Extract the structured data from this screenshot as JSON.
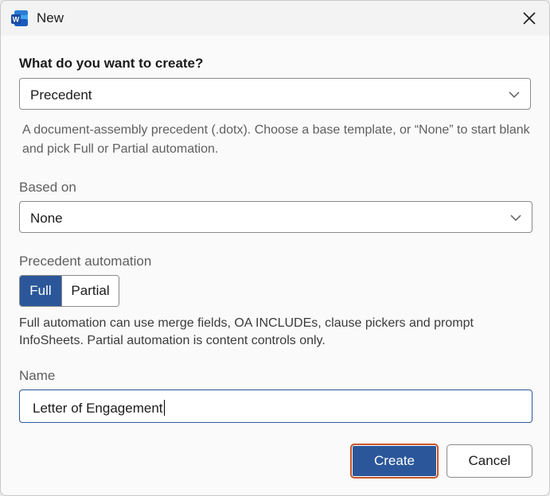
{
  "window": {
    "title": "New",
    "app_icon": "word-icon",
    "close_icon": "close-icon"
  },
  "form": {
    "heading": "What do you want to create?",
    "type_select": {
      "value": "Precedent",
      "icon": "chevron-down-icon"
    },
    "type_description": "A document-assembly precedent (.dotx). Choose a base template, or “None” to start blank and pick Full or Partial automation.",
    "based_on": {
      "label": "Based on",
      "value": "None",
      "icon": "chevron-down-icon"
    },
    "automation": {
      "label": "Precedent automation",
      "options": [
        "Full",
        "Partial"
      ],
      "selected": "Full",
      "help": "Full automation can use merge fields, OA INCLUDEs, clause pickers and prompt InfoSheets. Partial automation is content controls only."
    },
    "name": {
      "label": "Name",
      "value": "Letter of Engagement"
    }
  },
  "buttons": {
    "create": "Create",
    "cancel": "Cancel"
  },
  "colors": {
    "accent": "#2b579a",
    "focus_ring": "#c6562b"
  }
}
